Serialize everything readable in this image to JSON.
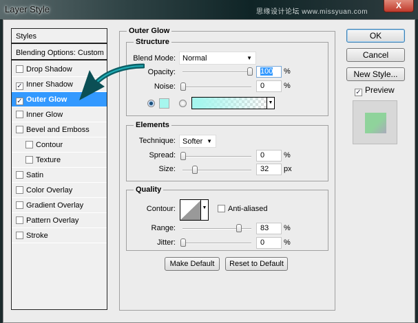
{
  "window": {
    "title": "Layer Style",
    "watermark": "思缘设计论坛 www.missyuan.com",
    "close": "X"
  },
  "styles_list": {
    "header": "Styles",
    "blending": "Blending Options: Custom",
    "items": [
      {
        "label": "Drop Shadow",
        "checked": false
      },
      {
        "label": "Inner Shadow",
        "checked": true
      },
      {
        "label": "Outer Glow",
        "checked": true,
        "selected": true
      },
      {
        "label": "Inner Glow",
        "checked": false
      },
      {
        "label": "Bevel and Emboss",
        "checked": false
      },
      {
        "label": "Contour",
        "checked": false,
        "indent": true
      },
      {
        "label": "Texture",
        "checked": false,
        "indent": true
      },
      {
        "label": "Satin",
        "checked": false
      },
      {
        "label": "Color Overlay",
        "checked": false
      },
      {
        "label": "Gradient Overlay",
        "checked": false
      },
      {
        "label": "Pattern Overlay",
        "checked": false
      },
      {
        "label": "Stroke",
        "checked": false
      }
    ]
  },
  "panel": {
    "title": "Outer Glow",
    "structure": {
      "title": "Structure",
      "blend_mode_label": "Blend Mode:",
      "blend_mode": "Normal",
      "opacity_label": "Opacity:",
      "opacity": "100",
      "opacity_unit": "%",
      "noise_label": "Noise:",
      "noise": "0",
      "noise_unit": "%",
      "glow_color": "#a6f6ee"
    },
    "elements": {
      "title": "Elements",
      "technique_label": "Technique:",
      "technique": "Softer",
      "spread_label": "Spread:",
      "spread": "0",
      "spread_unit": "%",
      "size_label": "Size:",
      "size": "32",
      "size_unit": "px"
    },
    "quality": {
      "title": "Quality",
      "contour_label": "Contour:",
      "anti_aliased_label": "Anti-aliased",
      "anti_aliased": false,
      "range_label": "Range:",
      "range": "83",
      "range_unit": "%",
      "jitter_label": "Jitter:",
      "jitter": "0",
      "jitter_unit": "%"
    },
    "make_default": "Make Default",
    "reset_default": "Reset to Default"
  },
  "actions": {
    "ok": "OK",
    "cancel": "Cancel",
    "new_style": "New Style...",
    "preview_label": "Preview",
    "preview_checked": true
  },
  "colors": {
    "selection": "#3399ff",
    "arrow": "#1aa6b0",
    "preview_fill": "#8fd39b"
  }
}
